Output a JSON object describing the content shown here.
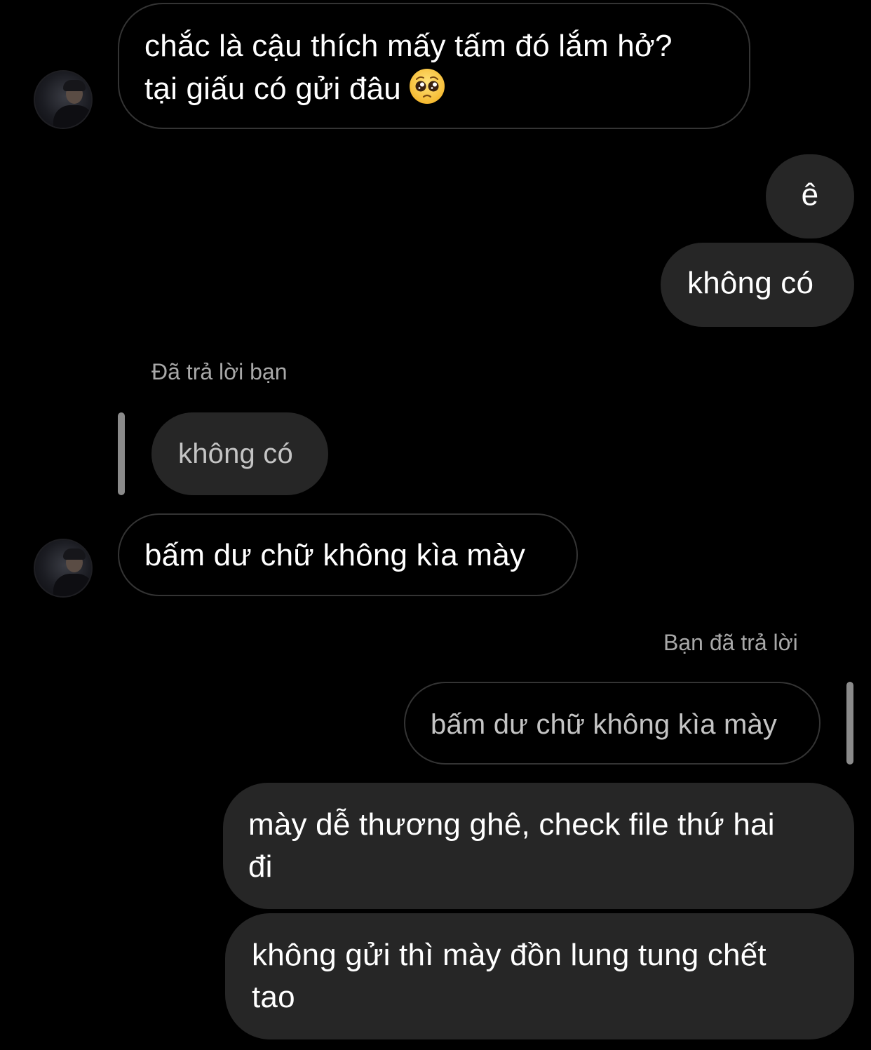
{
  "messages": [
    {
      "id": "m1",
      "sender": "other",
      "lines": [
        "chắc là cậu thích mấy tấm đó lắm hở?",
        "tại giấu có gửi đâu"
      ],
      "emoji": "pleading-face-emoji"
    },
    {
      "id": "m2",
      "sender": "me",
      "text": "ê"
    },
    {
      "id": "m3",
      "sender": "me",
      "text": "không có"
    },
    {
      "id": "m4",
      "sender": "other",
      "reply_label": "Đã trả lời bạn",
      "quoted_text": "không có",
      "text": "bấm dư chữ không kìa mày"
    },
    {
      "id": "m5",
      "sender": "me",
      "reply_label": "Bạn đã trả lời",
      "quoted_text": "bấm dư chữ không kìa mày",
      "lines": [
        "mày dễ thương ghê, check file thứ hai",
        "đi"
      ]
    },
    {
      "id": "m6",
      "sender": "me",
      "lines": [
        "không gửi thì mày đồn lung tung chết",
        "tao"
      ]
    }
  ],
  "colors": {
    "background": "#000000",
    "outgoing_bubble": "#262626",
    "incoming_border": "#343434",
    "meta_text": "#a8a8a8"
  }
}
